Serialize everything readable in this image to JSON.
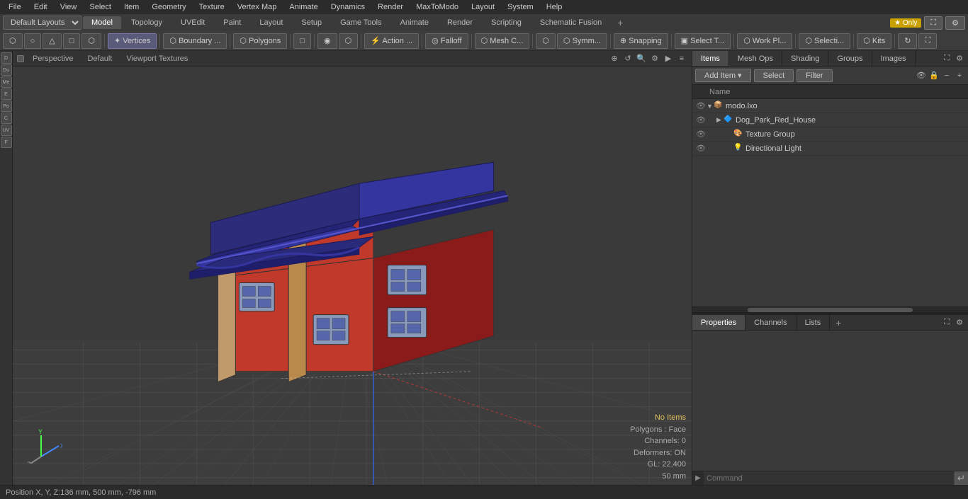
{
  "menubar": {
    "items": [
      "File",
      "Edit",
      "View",
      "Select",
      "Item",
      "Geometry",
      "Texture",
      "Vertex Map",
      "Animate",
      "Dynamics",
      "Render",
      "MaxToModo",
      "Layout",
      "System",
      "Help"
    ]
  },
  "layoutbar": {
    "dropdown_label": "Default Layouts",
    "tabs": [
      "Model",
      "Topology",
      "UVEdit",
      "Paint",
      "Layout",
      "Setup",
      "Game Tools",
      "Animate",
      "Render",
      "Scripting",
      "Schematic Fusion"
    ],
    "active_tab": "Model",
    "plus_label": "+",
    "star_label": "★ Only",
    "fullscreen_icon": "⛶",
    "settings_icon": "⚙"
  },
  "toolsbar": {
    "tools": [
      {
        "label": "⬡",
        "name": "component-mode"
      },
      {
        "label": "○",
        "name": "sphere-mode"
      },
      {
        "label": "△",
        "name": "tri-mode"
      },
      {
        "label": "□",
        "name": "quad-mode"
      },
      {
        "label": "⬡",
        "name": "ngon-mode"
      },
      {
        "sep": true
      },
      {
        "label": "✦ Vertices",
        "name": "vertices-btn"
      },
      {
        "sep": true
      },
      {
        "label": "⬡ Boundary ...",
        "name": "boundary-btn"
      },
      {
        "sep": true
      },
      {
        "label": "⬡ Polygons",
        "name": "polygons-btn"
      },
      {
        "sep": true
      },
      {
        "label": "□",
        "name": "edge-mode"
      },
      {
        "sep": true
      },
      {
        "label": "◉",
        "name": "mode1"
      },
      {
        "label": "⬡",
        "name": "mode2"
      },
      {
        "sep": true
      },
      {
        "label": "⚡ Action ...",
        "name": "action-btn"
      },
      {
        "sep": true
      },
      {
        "label": "◎ Falloff",
        "name": "falloff-btn"
      },
      {
        "sep": true
      },
      {
        "label": "⬡ Mesh C ...",
        "name": "mesh-btn"
      },
      {
        "sep": true
      },
      {
        "label": "⬡",
        "name": "sym-btn"
      },
      {
        "label": "⬡ Symm ...",
        "name": "symm-btn"
      },
      {
        "sep": true
      },
      {
        "label": "⊕ Snapping",
        "name": "snapping-btn"
      },
      {
        "sep": true
      },
      {
        "label": "▣ Select T...",
        "name": "select-t-btn"
      },
      {
        "sep": true
      },
      {
        "label": "⬡ Work Pl...",
        "name": "workplane-btn"
      },
      {
        "sep": true
      },
      {
        "label": "⬡ Selecti ...",
        "name": "selection-btn"
      },
      {
        "sep": true
      },
      {
        "label": "⬡ Kits",
        "name": "kits-btn"
      },
      {
        "sep": true
      },
      {
        "label": "↻",
        "name": "rotate-btn"
      },
      {
        "label": "⛶",
        "name": "fullscreen2-btn"
      }
    ]
  },
  "viewport": {
    "dot_color": "#555",
    "label_perspective": "Perspective",
    "label_default": "Default",
    "label_viewport_textures": "Viewport Textures",
    "controls": [
      "⊕",
      "↺",
      "🔍",
      "⚙",
      "▶",
      "≡"
    ],
    "info": {
      "no_items": "No Items",
      "polygons": "Polygons : Face",
      "channels": "Channels: 0",
      "deformers": "Deformers: ON",
      "gl": "GL: 22,400",
      "size": "50 mm"
    }
  },
  "statusbar": {
    "label": "Position X, Y, Z:",
    "value": "  136 mm, 500 mm, -796 mm"
  },
  "rightpanel": {
    "tabs": [
      "Items",
      "Mesh Ops",
      "Shading",
      "Groups",
      "Images"
    ],
    "active_tab": "Items",
    "tab_plus": "+",
    "toolbar": {
      "add_item_label": "Add Item",
      "add_arrow": "▾",
      "select_label": "Select",
      "filter_label": "Filter",
      "eye_icon": "👁",
      "lock_icon": "🔒",
      "minus_icon": "−",
      "plus_icon": "+"
    },
    "col_header": {
      "name_label": "Name"
    },
    "items": [
      {
        "id": "modo-lxo",
        "depth": 0,
        "arrow": "▼",
        "icon": "📦",
        "icon_color": "#aaa",
        "name": "modo.lxo",
        "eye": true
      },
      {
        "id": "dog-park",
        "depth": 1,
        "arrow": "▶",
        "icon": "🔷",
        "icon_color": "#6688cc",
        "name": "Dog_Park_Red_House",
        "eye": true
      },
      {
        "id": "texture-group",
        "depth": 2,
        "arrow": "",
        "icon": "🎨",
        "icon_color": "#aaccaa",
        "name": "Texture Group",
        "eye": true
      },
      {
        "id": "directional-light",
        "depth": 2,
        "arrow": "",
        "icon": "💡",
        "icon_color": "#cccc88",
        "name": "Directional Light",
        "eye": true
      }
    ]
  },
  "bottomtabs": {
    "tabs": [
      "Properties",
      "Channels",
      "Lists"
    ],
    "active_tab": "Properties",
    "plus_label": "+"
  },
  "commandbar": {
    "arrow_label": "▶",
    "placeholder": "Command",
    "go_label": "↵"
  },
  "colors": {
    "bg_dark": "#2b2b2b",
    "bg_mid": "#3a3a3a",
    "bg_light": "#4a4a4a",
    "accent_blue": "#4a5a8a",
    "border": "#222",
    "text_normal": "#ccc",
    "text_dim": "#888"
  },
  "axes": {
    "x_label": "X",
    "y_label": "Y",
    "z_label": "Z"
  }
}
